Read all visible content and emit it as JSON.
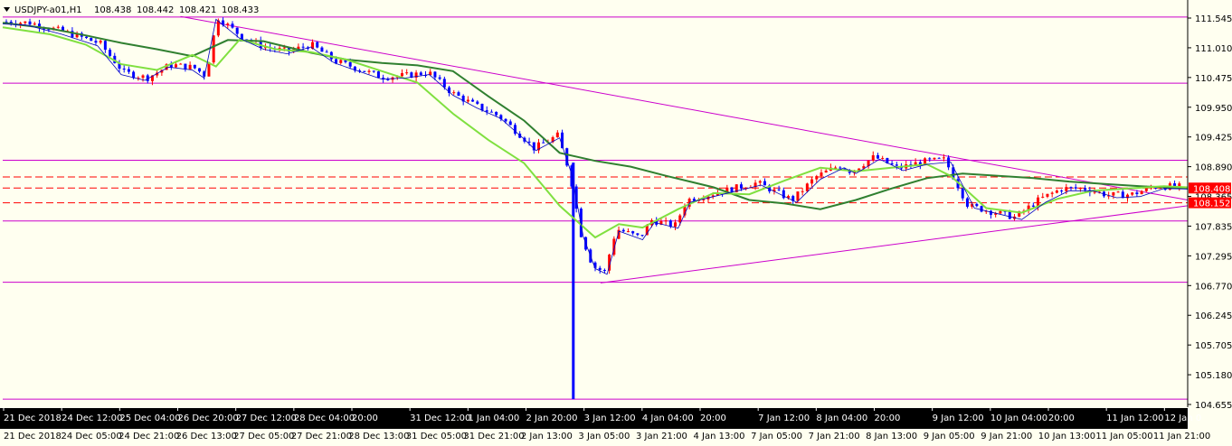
{
  "chart_data": {
    "type": "candlestick",
    "title": "USDJPY-a01,H1",
    "ohlc": [
      "108.438",
      "108.442",
      "108.421",
      "108.433"
    ],
    "ylim": [
      104.6,
      111.55
    ],
    "y_ticks": [
      "111.545",
      "111.010",
      "110.475",
      "109.950",
      "109.425",
      "108.890",
      "108.365",
      "107.835",
      "107.295",
      "106.770",
      "106.245",
      "105.705",
      "105.180",
      "104.655"
    ],
    "price_labels": [
      {
        "value": "108.408",
        "price": 108.408
      },
      {
        "value": "108.152",
        "price": 108.152
      }
    ],
    "x_ticks_top": [
      "21 Dec 2018",
      "24 Dec 12:00",
      "25 Dec 04:00",
      "26 Dec 20:00",
      "27 Dec 12:00",
      "28 Dec 04:00",
      "20:00",
      "31 Dec 12:00",
      "1 Jan 04:00",
      "2 Jan 20:00",
      "3 Jan 12:00",
      "4 Jan 04:00",
      "20:00",
      "7 Jan 12:00",
      "8 Jan 04:00",
      "20:00",
      "9 Jan 12:00",
      "10 Jan 04:00",
      "20:00",
      "11 Jan 12:00",
      "12 Jan 0"
    ],
    "x_ticks_bottom": [
      "21 Dec 2018",
      "24 Dec 05:00",
      "24 Dec 21:00",
      "26 Dec 13:00",
      "27 Dec 05:00",
      "27 Dec 21:00",
      "28 Dec 13:00",
      "31 Dec 05:00",
      "31 Dec 21:00",
      "2 Jan 13:00",
      "3 Jan 05:00",
      "3 Jan 21:00",
      "4 Jan 13:00",
      "7 Jan 05:00",
      "7 Jan 21:00",
      "8 Jan 13:00",
      "9 Jan 05:00",
      "9 Jan 21:00",
      "10 Jan 13:00",
      "11 Jan 05:00",
      "11 Jan 21:00"
    ],
    "horizontal_levels": [
      111.38,
      110.23,
      108.89,
      107.835,
      106.77,
      104.74
    ],
    "dashed_levels": [
      108.6,
      108.408,
      108.152
    ],
    "trendlines": [
      {
        "from": [
          "26 Dec 20:00",
          111.39
        ],
        "to": [
          "12 Jan 0",
          108.2
        ]
      },
      {
        "from": [
          "3 Jan 05:00",
          106.76
        ],
        "to": [
          "12 Jan 0",
          108.1
        ]
      }
    ],
    "ma_slow": [
      [
        0,
        111.28
      ],
      [
        0.04,
        111.18
      ],
      [
        0.07,
        111.06
      ],
      [
        0.1,
        110.93
      ],
      [
        0.13,
        110.82
      ],
      [
        0.16,
        110.7
      ],
      [
        0.19,
        110.98
      ],
      [
        0.22,
        110.96
      ],
      [
        0.26,
        110.76
      ],
      [
        0.29,
        110.64
      ],
      [
        0.32,
        110.58
      ],
      [
        0.35,
        110.54
      ],
      [
        0.38,
        110.44
      ],
      [
        0.41,
        110.0
      ],
      [
        0.44,
        109.58
      ],
      [
        0.47,
        109.02
      ],
      [
        0.5,
        108.88
      ],
      [
        0.53,
        108.78
      ],
      [
        0.56,
        108.62
      ],
      [
        0.6,
        108.42
      ],
      [
        0.63,
        108.2
      ],
      [
        0.66,
        108.14
      ],
      [
        0.69,
        108.04
      ],
      [
        0.72,
        108.2
      ],
      [
        0.75,
        108.4
      ],
      [
        0.78,
        108.58
      ],
      [
        0.81,
        108.66
      ],
      [
        0.84,
        108.62
      ],
      [
        0.87,
        108.58
      ],
      [
        0.9,
        108.52
      ],
      [
        0.93,
        108.48
      ],
      [
        0.96,
        108.44
      ],
      [
        1,
        108.4
      ]
    ],
    "ma_fast": [
      [
        0,
        111.2
      ],
      [
        0.04,
        111.08
      ],
      [
        0.07,
        110.9
      ],
      [
        0.1,
        110.56
      ],
      [
        0.13,
        110.46
      ],
      [
        0.16,
        110.72
      ],
      [
        0.18,
        110.52
      ],
      [
        0.2,
        110.99
      ],
      [
        0.23,
        110.82
      ],
      [
        0.26,
        110.77
      ],
      [
        0.29,
        110.64
      ],
      [
        0.32,
        110.44
      ],
      [
        0.35,
        110.24
      ],
      [
        0.38,
        109.7
      ],
      [
        0.41,
        109.24
      ],
      [
        0.44,
        108.84
      ],
      [
        0.47,
        108.1
      ],
      [
        0.5,
        107.55
      ],
      [
        0.52,
        107.78
      ],
      [
        0.54,
        107.72
      ],
      [
        0.57,
        108.04
      ],
      [
        0.6,
        108.32
      ],
      [
        0.63,
        108.3
      ],
      [
        0.66,
        108.54
      ],
      [
        0.69,
        108.76
      ],
      [
        0.72,
        108.7
      ],
      [
        0.75,
        108.76
      ],
      [
        0.78,
        108.82
      ],
      [
        0.8,
        108.62
      ],
      [
        0.83,
        108.06
      ],
      [
        0.86,
        107.98
      ],
      [
        0.89,
        108.22
      ],
      [
        0.92,
        108.36
      ],
      [
        0.95,
        108.4
      ],
      [
        0.98,
        108.44
      ],
      [
        1,
        108.42
      ]
    ],
    "candle_path": [
      [
        0,
        111.3
      ],
      [
        0.02,
        111.28
      ],
      [
        0.05,
        111.12
      ],
      [
        0.08,
        110.92
      ],
      [
        0.1,
        110.42
      ],
      [
        0.12,
        110.32
      ],
      [
        0.14,
        110.55
      ],
      [
        0.16,
        110.5
      ],
      [
        0.17,
        110.36
      ],
      [
        0.18,
        111.38
      ],
      [
        0.2,
        111.05
      ],
      [
        0.22,
        110.86
      ],
      [
        0.24,
        110.78
      ],
      [
        0.26,
        110.9
      ],
      [
        0.28,
        110.62
      ],
      [
        0.3,
        110.48
      ],
      [
        0.32,
        110.34
      ],
      [
        0.34,
        110.36
      ],
      [
        0.36,
        110.42
      ],
      [
        0.38,
        110.06
      ],
      [
        0.4,
        109.84
      ],
      [
        0.42,
        109.66
      ],
      [
        0.44,
        109.3
      ],
      [
        0.45,
        109.1
      ],
      [
        0.47,
        109.32
      ],
      [
        0.48,
        108.7
      ],
      [
        0.49,
        107.6
      ],
      [
        0.5,
        107.05
      ],
      [
        0.51,
        106.95
      ],
      [
        0.52,
        107.7
      ],
      [
        0.54,
        107.55
      ],
      [
        0.55,
        107.85
      ],
      [
        0.57,
        107.75
      ],
      [
        0.58,
        108.2
      ],
      [
        0.6,
        108.3
      ],
      [
        0.62,
        108.4
      ],
      [
        0.64,
        108.5
      ],
      [
        0.66,
        108.3
      ],
      [
        0.67,
        108.2
      ],
      [
        0.69,
        108.6
      ],
      [
        0.71,
        108.8
      ],
      [
        0.72,
        108.7
      ],
      [
        0.74,
        108.95
      ],
      [
        0.76,
        108.75
      ],
      [
        0.78,
        108.86
      ],
      [
        0.8,
        108.9
      ],
      [
        0.82,
        108.1
      ],
      [
        0.84,
        108.0
      ],
      [
        0.86,
        107.9
      ],
      [
        0.88,
        108.2
      ],
      [
        0.9,
        108.4
      ],
      [
        0.92,
        108.4
      ],
      [
        0.94,
        108.28
      ],
      [
        0.96,
        108.3
      ],
      [
        0.98,
        108.44
      ],
      [
        1,
        108.43
      ]
    ],
    "flash_crash": {
      "x": 0.48,
      "low": 104.74,
      "high": 108.85
    },
    "colors": {
      "bull": "#ff0000",
      "bear": "#0000ff",
      "ma_fast": "#80e040",
      "ma_slow": "#308030",
      "signal": "#0000c0",
      "levels": "#cc00cc",
      "dashed": "#ff0000",
      "axis_bar": "#000000"
    }
  }
}
